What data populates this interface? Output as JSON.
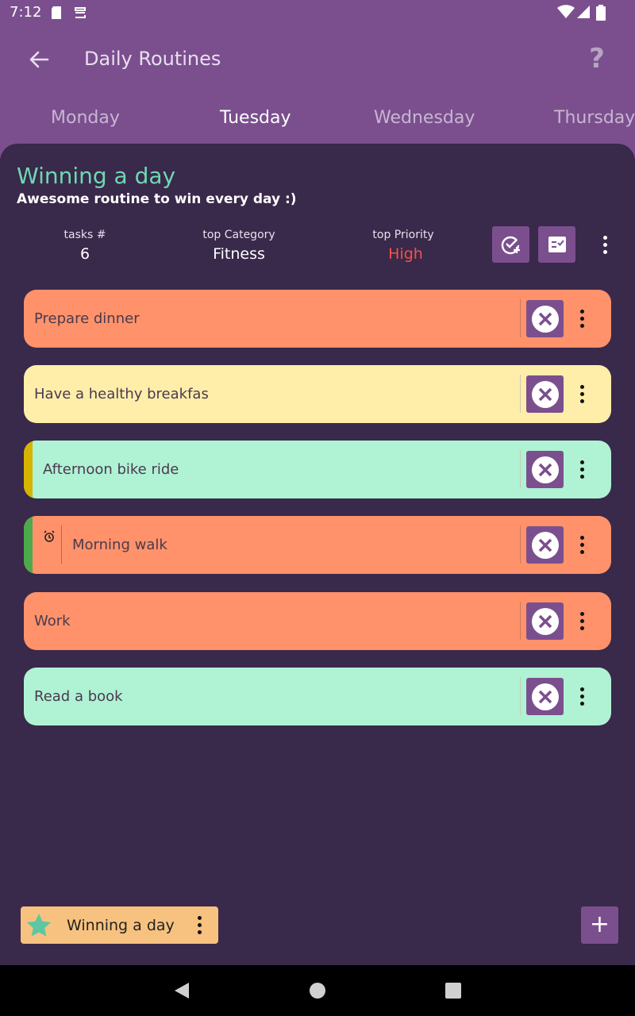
{
  "status_bar": {
    "time": "7:12"
  },
  "appbar": {
    "title": "Daily Routines",
    "help": "?"
  },
  "tabs": [
    {
      "label": "Monday"
    },
    {
      "label": "Tuesday",
      "active": true
    },
    {
      "label": "Wednesday"
    },
    {
      "label": "Thursday"
    }
  ],
  "routine": {
    "title": "Winning a day",
    "description": "Awesome routine to win every day :)",
    "stats": {
      "tasks_label": "tasks #",
      "tasks_value": "6",
      "category_label": "top Category",
      "category_value": "Fitness",
      "priority_label": "top Priority",
      "priority_value": "High"
    }
  },
  "tasks": [
    {
      "label": "Prepare dinner",
      "color": "#ff926a"
    },
    {
      "label": "Have a healthy breakfas",
      "color": "#ffeeaa"
    },
    {
      "label": "Afternoon bike ride",
      "color": "#b0f2d4",
      "stripe": "#d6b400"
    },
    {
      "label": "Morning walk",
      "color": "#ff926a",
      "stripe": "#4caa4c",
      "icon": "alarm-icon"
    },
    {
      "label": "Work",
      "color": "#ff926a"
    },
    {
      "label": "Read a book",
      "color": "#b0f2d4"
    }
  ],
  "bottom": {
    "chip_label": "Winning a day",
    "fab_label": "+"
  },
  "colors": {
    "appbar": "#7b4f8e",
    "background": "#39294a",
    "accent_green": "#6fd8b4",
    "priority_red": "#f2524b",
    "chip": "#f7c27f"
  }
}
